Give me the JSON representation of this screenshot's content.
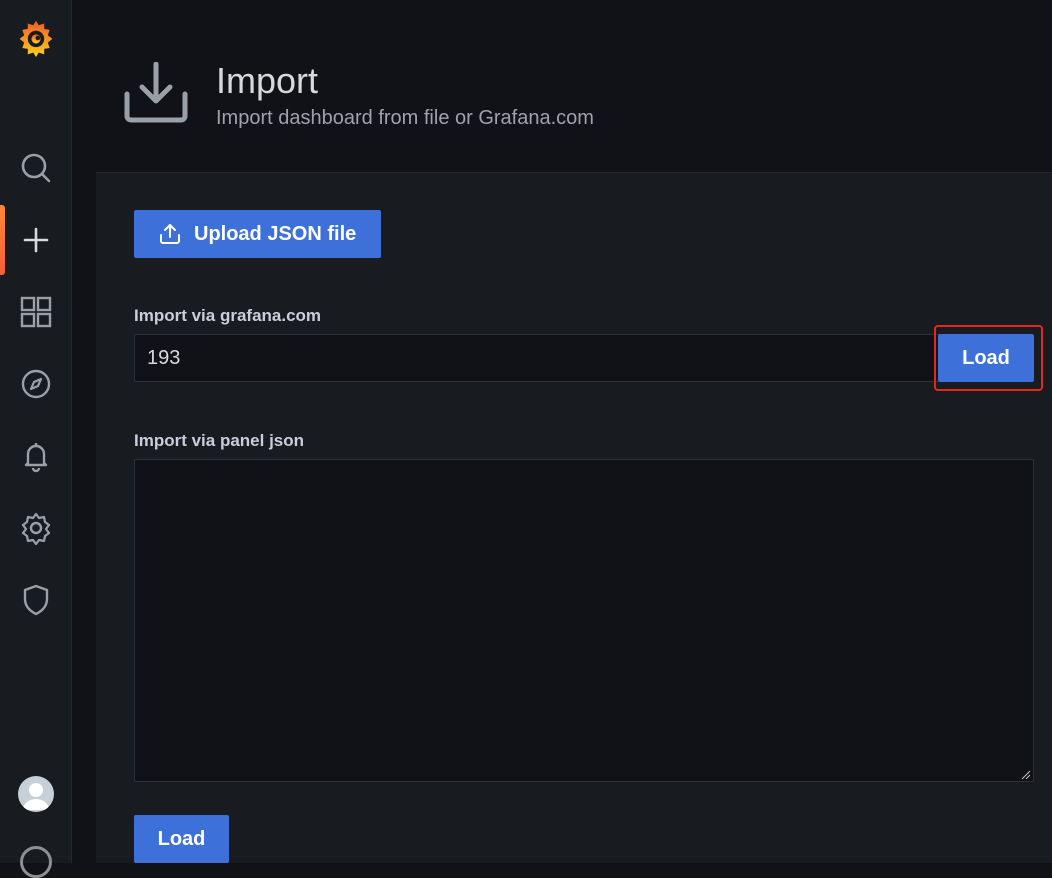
{
  "sidebar": {
    "items": [
      {
        "icon": "search-icon"
      },
      {
        "icon": "plus-icon",
        "active": true
      },
      {
        "icon": "dashboards-icon"
      },
      {
        "icon": "explore-compass-icon"
      },
      {
        "icon": "alerting-bell-icon"
      },
      {
        "icon": "configuration-gear-icon"
      },
      {
        "icon": "server-admin-shield-icon"
      }
    ],
    "active_color": "#ff8833"
  },
  "header": {
    "title": "Import",
    "subtitle": "Import dashboard from file or Grafana.com",
    "icon": "import-download-icon"
  },
  "upload": {
    "label": "Upload JSON file",
    "icon": "upload-icon"
  },
  "grafana_import": {
    "label": "Import via grafana.com",
    "value": "193",
    "load_label": "Load"
  },
  "panel_json": {
    "label": "Import via panel json",
    "value": ""
  },
  "footer": {
    "load_label": "Load"
  },
  "colors": {
    "primary": "#3d71d9",
    "highlight": "#e5281f",
    "background": "#111217",
    "panel": "#181b1f"
  }
}
